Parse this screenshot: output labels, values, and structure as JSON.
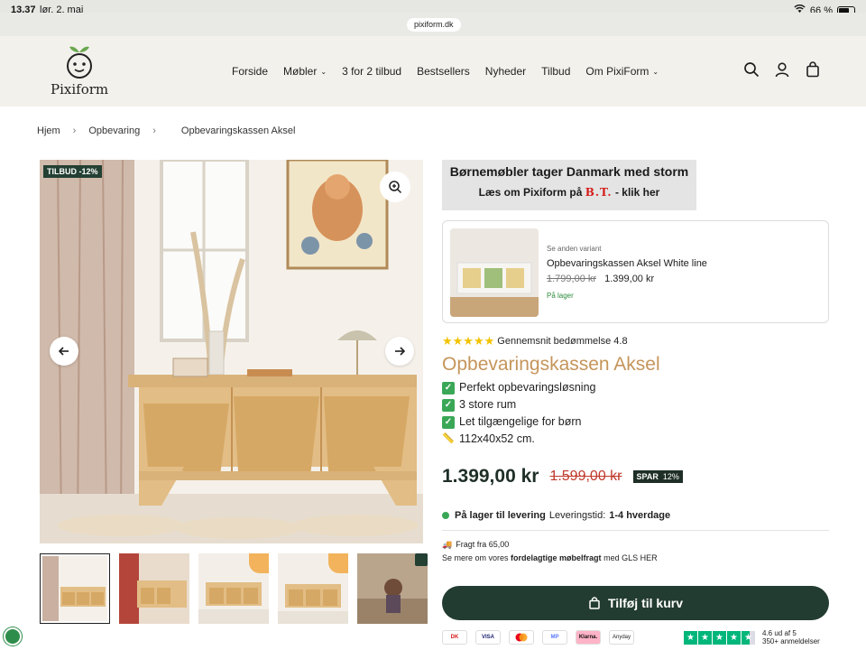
{
  "status": {
    "time": "13.37",
    "date": "lør. 2. maj",
    "battery": "66 %"
  },
  "browser": {
    "url": "pixiform.dk"
  },
  "header": {
    "brand": "Pixiform",
    "nav": [
      {
        "label": "Forside",
        "dropdown": false
      },
      {
        "label": "Møbler",
        "dropdown": true
      },
      {
        "label": "3 for 2 tilbud",
        "dropdown": false
      },
      {
        "label": "Bestsellers",
        "dropdown": false
      },
      {
        "label": "Nyheder",
        "dropdown": false
      },
      {
        "label": "Tilbud",
        "dropdown": false
      },
      {
        "label": "Om PixiForm",
        "dropdown": true
      }
    ],
    "icons": [
      "search-icon",
      "account-icon",
      "bag-icon"
    ]
  },
  "breadcrumb": {
    "home": "Hjem",
    "category": "Opbevaring",
    "current": "Opbevaringskassen Aksel"
  },
  "gallery": {
    "badge": "TILBUD -12%",
    "thumb_count": 5,
    "active_thumb": 1
  },
  "promo": {
    "line1": "Børnemøbler tager Danmark med storm",
    "line2_prefix": "Læs om Pixiform på",
    "line2_brand": "B.T.",
    "line2_suffix": "- klik her"
  },
  "variant": {
    "label": "Se anden variant",
    "title": "Opbevaringskassen Aksel White line",
    "old_price": "1.799,00 kr",
    "price": "1.399,00 kr",
    "stock": "På lager"
  },
  "rating": {
    "stars": 5,
    "text": "Gennemsnit bedømmelse 4.8"
  },
  "product": {
    "title": "Opbevaringskassen Aksel",
    "features": [
      "Perfekt opbevaringsløsning",
      "3 store rum",
      "Let tilgængelige for børn"
    ],
    "dimensions": "112x40x52 cm.",
    "price": "1.399,00 kr",
    "old_price": "1.599,00 kr",
    "save_label": "SPAR",
    "save_value": "12%"
  },
  "stock": {
    "status": "På lager til levering",
    "delivery_label": "Leveringstid:",
    "delivery_value": "1-4 hverdage"
  },
  "shipping": {
    "line1": "Fragt fra 65,00",
    "line2_prefix": "Se mere om vores",
    "line2_bold": "fordelagtige møbelfragt",
    "line2_suffix": "med GLS HER"
  },
  "cart": {
    "label": "Tilføj til kurv"
  },
  "payments": [
    "Dankort",
    "VISA",
    "Mastercard",
    "MobilePay",
    "Klarna.",
    "Anyday"
  ],
  "trustpilot": {
    "line1": "4.6 ud af 5",
    "line2": "350+ anmeldelser"
  },
  "colors": {
    "accent_dark_green": "#233c31",
    "title_gold": "#c5955b",
    "header_bg": "#f3f1ec",
    "old_price_red": "#c0392b",
    "stock_green": "#3aa757"
  }
}
